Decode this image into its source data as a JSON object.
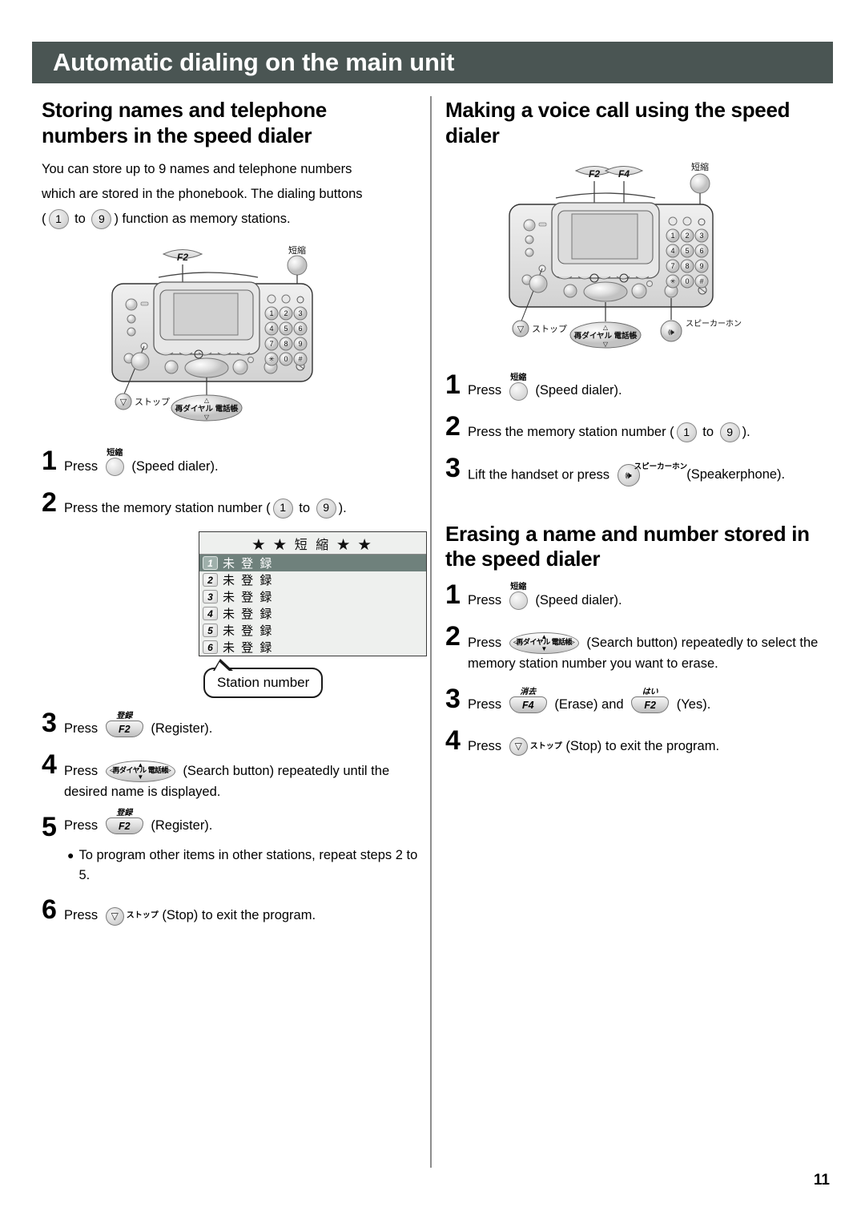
{
  "header": {
    "title": "Automatic dialing on the main unit"
  },
  "page_number": "11",
  "left": {
    "section_title": "Storing names and telephone numbers in the speed dialer",
    "intro_line1": "You can store up to 9 names and telephone numbers",
    "intro_line2": "which are stored in the phonebook. The dialing buttons",
    "intro_prefix": "(",
    "intro_mid": "to",
    "intro_suffix": ") function as memory stations.",
    "key_1": "1",
    "key_9": "9",
    "steps": {
      "s1_num": "1",
      "s1_press": "Press",
      "s1_cap": "短縮",
      "s1_label": "(Speed dialer).",
      "s2_num": "2",
      "s2_text_a": "Press the memory station number (",
      "s2_to": "to",
      "s2_text_b": ").",
      "s3_num": "3",
      "s3_press": "Press",
      "s3_cap": "登録",
      "s3_key": "F2",
      "s3_label": "(Register).",
      "s4_num": "4",
      "s4_press": "Press",
      "s4_label": "(Search button) repeatedly until the desired name is displayed.",
      "s5_num": "5",
      "s5_press": "Press",
      "s5_cap": "登録",
      "s5_key": "F2",
      "s5_label": "(Register).",
      "s5_note": "To program other items in other stations, repeat steps 2 to 5.",
      "s6_num": "6",
      "s6_press": "Press",
      "s6_cap": "ストップ",
      "s6_label": "(Stop) to exit the program."
    },
    "lcd": {
      "title": "★ ★ 短 縮 ★ ★",
      "rows": [
        {
          "index": "1",
          "text": "未 登 録",
          "selected": true
        },
        {
          "index": "2",
          "text": "未 登 録",
          "selected": false
        },
        {
          "index": "3",
          "text": "未 登 録",
          "selected": false
        },
        {
          "index": "4",
          "text": "未 登 録",
          "selected": false
        },
        {
          "index": "5",
          "text": "未 登 録",
          "selected": false
        },
        {
          "index": "6",
          "text": "未 登 録",
          "selected": false
        }
      ],
      "callout": "Station number"
    },
    "fax_labels": {
      "f2": "F2",
      "speed": "短縮",
      "stop": "ストップ",
      "search": "再ダイヤル 電話帳"
    }
  },
  "right": {
    "section_title_1": "Making a voice call using the speed dialer",
    "section_title_2": "Erasing a name and number stored in the speed dialer",
    "fax_labels": {
      "f2": "F2",
      "f4": "F4",
      "speed": "短縮",
      "stop": "ストップ",
      "search": "再ダイヤル 電話帳",
      "speaker": "スピーカーホン"
    },
    "voice_steps": {
      "s1_num": "1",
      "s1_press": "Press",
      "s1_cap": "短縮",
      "s1_label": "(Speed dialer).",
      "s2_num": "2",
      "s2_text_a": "Press the memory station number (",
      "s2_to": "to",
      "s2_text_b": ").",
      "s3_num": "3",
      "s3_press": "Lift the handset or press",
      "s3_cap": "スピーカーホン",
      "s3_label": "(Speakerphone)."
    },
    "erase_steps": {
      "s1_num": "1",
      "s1_press": "Press",
      "s1_cap": "短縮",
      "s1_label": "(Speed dialer).",
      "s2_num": "2",
      "s2_press": "Press",
      "s2_label": "(Search button) repeatedly to select the memory station number you want to erase.",
      "s3_num": "3",
      "s3_press": "Press",
      "s3_cap_erase": "消去",
      "s3_key_erase": "F4",
      "s3_mid": "(Erase) and",
      "s3_cap_yes": "はい",
      "s3_key_yes": "F2",
      "s3_end": "(Yes).",
      "s4_num": "4",
      "s4_press": "Press",
      "s4_cap": "ストップ",
      "s4_label": "(Stop) to exit the program."
    },
    "key_1": "1",
    "key_9": "9"
  },
  "colors": {
    "header_bar": "#4a5553",
    "lcd_selected": "#6f817c",
    "lcd_bg": "#eef0ee"
  }
}
